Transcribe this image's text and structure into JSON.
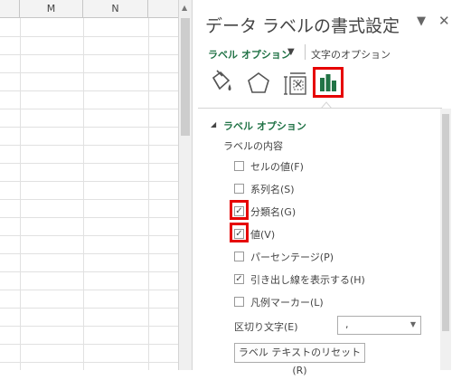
{
  "spreadsheet": {
    "columns": [
      "M",
      "N"
    ]
  },
  "pane": {
    "title": "データ ラベルの書式設定",
    "collapse_icon": "chevron-down-icon",
    "close_icon": "close-icon",
    "tabs": {
      "label_options": "ラベル オプション",
      "text_options": "文字のオプション"
    },
    "icons": [
      "paint-bucket-icon",
      "pentagon-icon",
      "size-properties-icon",
      "bar-chart-icon"
    ],
    "accent_color": "#217346",
    "highlight_color": "#e60000",
    "section_title": "ラベル オプション",
    "group_label": "ラベルの内容",
    "checkboxes": [
      {
        "label": "セルの値(F)",
        "checked": false
      },
      {
        "label": "系列名(S)",
        "checked": false
      },
      {
        "label": "分類名(G)",
        "checked": true
      },
      {
        "label": "値(V)",
        "checked": true
      },
      {
        "label": "パーセンテージ(P)",
        "checked": false
      },
      {
        "label": "引き出し線を表示する(H)",
        "checked": true
      },
      {
        "label": "凡例マーカー(L)",
        "checked": false
      }
    ],
    "separator_label": "区切り文字(E)",
    "separator_value": ",",
    "reset_button": "ラベル テキストのリセット(R)"
  }
}
